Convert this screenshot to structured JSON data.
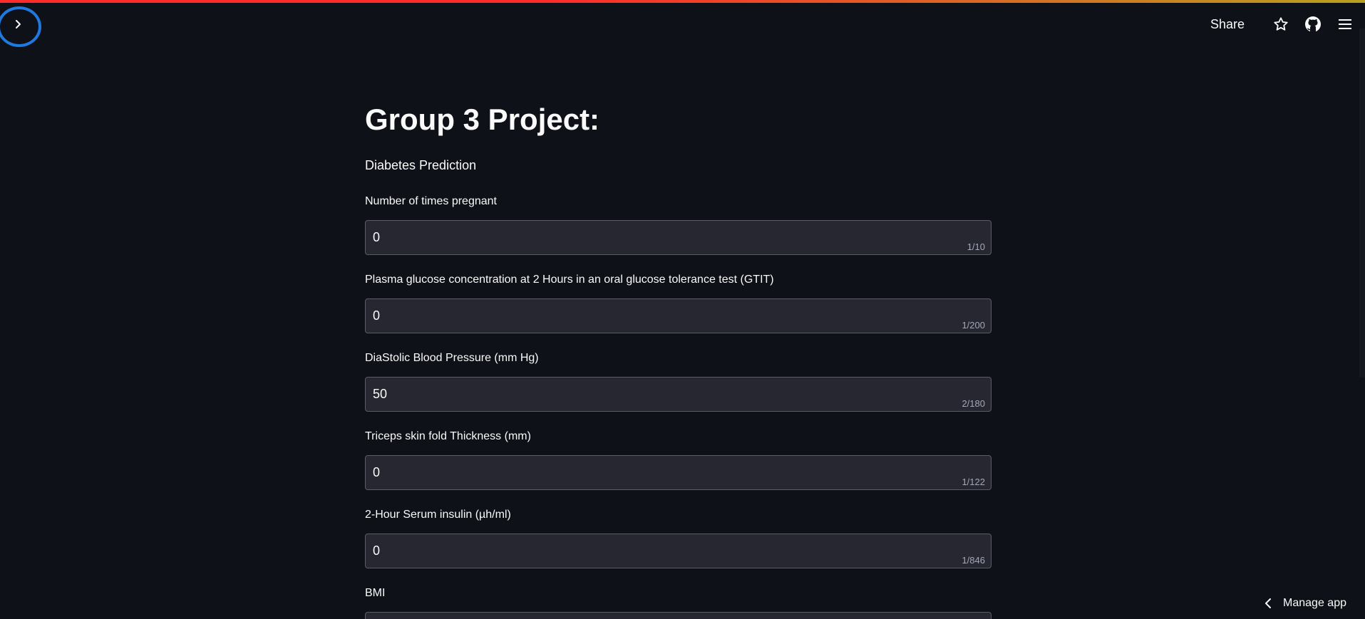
{
  "header": {
    "share_label": "Share",
    "icons": [
      "chevron-right-icon",
      "star-icon",
      "github-icon",
      "hamburger-menu-icon"
    ]
  },
  "main": {
    "title": "Group 3 Project:",
    "subtitle": "Diabetes Prediction",
    "fields": [
      {
        "label": "Number of times pregnant",
        "value": "0",
        "counter": "1/10"
      },
      {
        "label": "Plasma glucose concentration at 2 Hours in an oral glucose tolerance test (GTIT)",
        "value": "0",
        "counter": "1/200"
      },
      {
        "label": "DiaStolic Blood Pressure (mm Hg)",
        "value": "50",
        "counter": "2/180"
      },
      {
        "label": "Triceps skin fold Thickness (mm)",
        "value": "0",
        "counter": "1/122"
      },
      {
        "label": "2-Hour Serum insulin (µh/ml)",
        "value": "0",
        "counter": "1/846"
      },
      {
        "label": "BMI",
        "value": "",
        "counter": ""
      }
    ]
  },
  "footer": {
    "manage_app_label": "Manage app"
  },
  "colors": {
    "background": "#0e1117",
    "input_background": "#262730",
    "annotation_circle": "#1f7ae0",
    "accent_bar": "#ff2b2b"
  }
}
